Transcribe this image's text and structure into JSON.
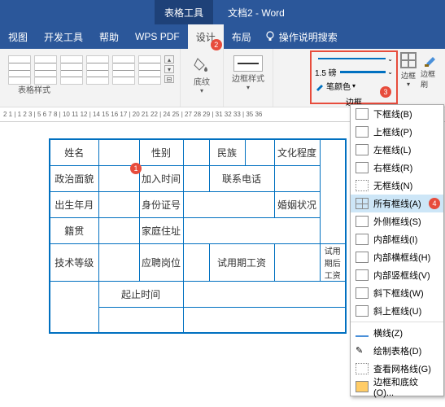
{
  "titlebar": {
    "tool": "表格工具",
    "doc": "文档2 - Word"
  },
  "tabs": {
    "view": "视图",
    "dev": "开发工具",
    "help": "帮助",
    "wps": "WPS PDF",
    "design": "设计",
    "layout": "布局",
    "tell": "操作说明搜索"
  },
  "markers": {
    "m1": "1",
    "m2": "2",
    "m3": "3",
    "m4": "4"
  },
  "ribbon": {
    "stylelabel": "表格样式",
    "shading": "底纹",
    "borderstyle": "边框样式",
    "weight": "1.5 磅",
    "pencolor": "笔颜色",
    "bordergroup": "边框",
    "borderbtn": "边框",
    "brushbtn": "边框刷"
  },
  "ruler": "2  1  |  1  2  3  |  5  6  7  8  |  10 11 12 |  14 15 16 17 | 20 21 22 | 24 25 | 27 28 29 | 31 32 33 | 35 36",
  "table": {
    "r1": {
      "c1": "姓名",
      "c2": "性别",
      "c3": "民族",
      "c4": "文化程度"
    },
    "r2": {
      "c1": "政治面貌",
      "c2": "加入时间",
      "c3": "联系电话"
    },
    "r3": {
      "c1": "出生年月",
      "c2": "身份证号",
      "c3": "婚姻状况"
    },
    "r4": {
      "c1": "籍贯",
      "c2": "家庭住址"
    },
    "r5": {
      "c1": "技术等级",
      "c2": "应聘岗位",
      "c3": "试用期工资",
      "c4": "试用期后工资"
    },
    "r6": {
      "c1": "起止时间"
    }
  },
  "dropdown": {
    "bottom": "下框线(B)",
    "top": "上框线(P)",
    "left": "左框线(L)",
    "right": "右框线(R)",
    "none": "无框线(N)",
    "all": "所有框线(A)",
    "outside": "外侧框线(S)",
    "inside": "内部框线(I)",
    "ihoriz": "内部横框线(H)",
    "ivert": "内部竖框线(V)",
    "diagdown": "斜下框线(W)",
    "diagup": "斜上框线(U)",
    "horiz": "横线(Z)",
    "draw": "绘制表格(D)",
    "viewgrid": "查看网格线(G)",
    "bordersshading": "边框和底纹(O)..."
  }
}
